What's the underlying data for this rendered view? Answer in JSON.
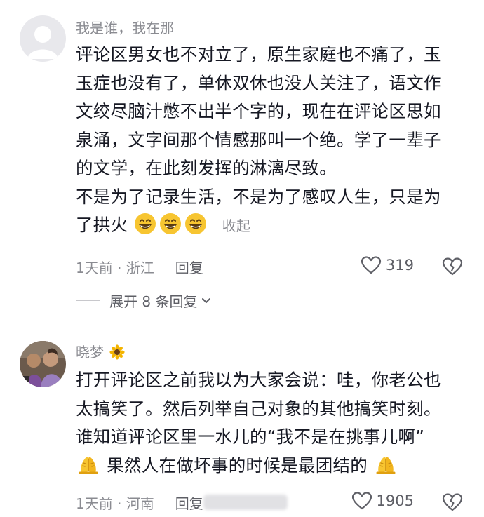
{
  "comments": [
    {
      "username": "我是谁，我在那",
      "lines": [
        "评论区男女也不对立了，原生家庭也不痛了，玉",
        "玉症也没有了，单休双休也没人关注了，语文作",
        "文绞尽脑汁憋不出半个字的，现在在评论区思如",
        "泉涌，文字间那个情感那叫一个绝。学了一辈子",
        "的文学，在此刻发挥的淋漓尽致。",
        "不是为了记录生活，不是为了感叹人生，只是为"
      ],
      "last_line": "了拱火",
      "emojis": [
        "grinning-face",
        "grinning-face",
        "grinning-face"
      ],
      "collapse_label": "收起",
      "time_location": "1天前 · 浙江",
      "reply_label": "回复",
      "likes": "319",
      "expand_label": "展开 8 条回复"
    },
    {
      "username": "晓梦",
      "username_emoji": "sunflower",
      "lines": [
        "打开评论区之前我以为大家会说：哇，你老公也",
        "太搞笑了。然后列举自己对象的其他搞笑时刻。",
        "谁知道评论区里一水儿的“我不是在挑事儿啊”"
      ],
      "last_line": "果然人在做坏事的时候是最团结的",
      "emojis": [
        "folded-hands",
        "folded-hands"
      ],
      "time_location": "1天前 · 河南",
      "reply_label": "回复",
      "likes": "1905"
    }
  ],
  "colors": {
    "text": "#161823",
    "meta": "#8a8b91",
    "secondary": "#5e5f66",
    "avatar_default": "#d9d9de"
  }
}
